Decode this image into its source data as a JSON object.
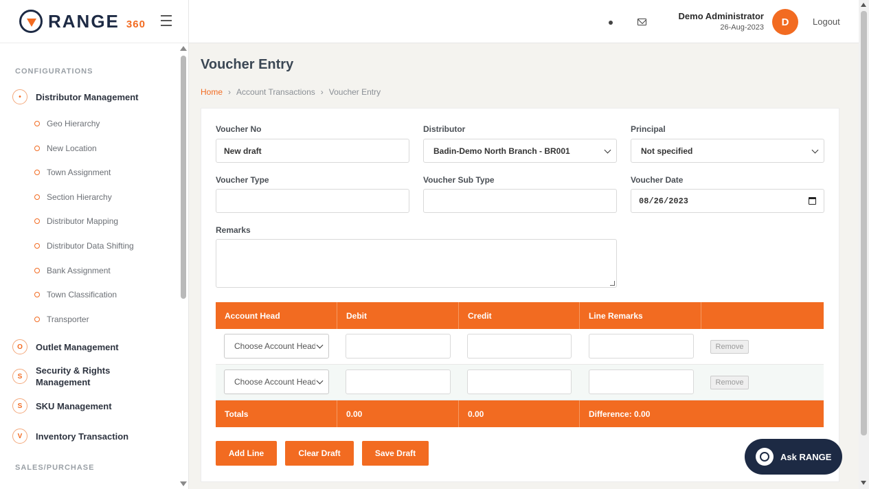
{
  "brand": {
    "name": "RANGE",
    "suffix": "360"
  },
  "header": {
    "user_name": "Demo Administrator",
    "date": "26-Aug-2023",
    "avatar_initial": "D",
    "logout_label": "Logout"
  },
  "sidebar": {
    "section_configurations": "CONFIGURATIONS",
    "section_sales": "SALES/PURCHASE",
    "distributor_management": {
      "badge": "•",
      "label": "Distributor Management"
    },
    "sub_items": [
      "Geo Hierarchy",
      "New Location",
      "Town Assignment",
      "Section Hierarchy",
      "Distributor Mapping",
      "Distributor Data Shifting",
      "Bank Assignment",
      "Town Classification",
      "Transporter"
    ],
    "outlet_management": {
      "badge": "O",
      "label": "Outlet Management"
    },
    "security": {
      "badge": "S",
      "label": "Security & Rights Management"
    },
    "sku": {
      "badge": "S",
      "label": "SKU Management"
    },
    "inventory": {
      "badge": "V",
      "label": "Inventory Transaction"
    }
  },
  "page": {
    "title": "Voucher Entry",
    "breadcrumb": [
      "Home",
      "Account Transactions",
      "Voucher Entry"
    ]
  },
  "form": {
    "voucher_no_label": "Voucher No",
    "voucher_no_value": "New draft",
    "distributor_label": "Distributor",
    "distributor_value": "Badin-Demo North Branch - BR001",
    "principal_label": "Principal",
    "principal_value": "Not specified",
    "voucher_type_label": "Voucher Type",
    "voucher_type_value": "",
    "voucher_sub_type_label": "Voucher Sub Type",
    "voucher_sub_type_value": "",
    "voucher_date_label": "Voucher Date",
    "voucher_date_value": "08/26/2023",
    "remarks_label": "Remarks",
    "remarks_value": ""
  },
  "table": {
    "headers": [
      "Account Head",
      "Debit",
      "Credit",
      "Line Remarks",
      ""
    ],
    "rows": [
      {
        "account_head": "Choose Account Head",
        "remove_label": "Remove"
      },
      {
        "account_head": "Choose Account Head",
        "remove_label": "Remove"
      }
    ],
    "totals": {
      "label": "Totals",
      "debit": "0.00",
      "credit": "0.00",
      "difference": "Difference: 0.00"
    }
  },
  "actions": {
    "add_line": "Add Line",
    "clear_draft": "Clear Draft",
    "save_draft": "Save Draft"
  },
  "assistant": {
    "label": "Ask RANGE"
  },
  "colors": {
    "accent": "#f26b21",
    "navy": "#1d2a44"
  }
}
